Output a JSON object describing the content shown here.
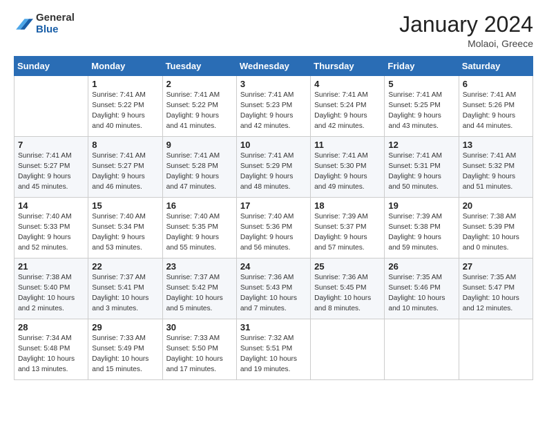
{
  "header": {
    "logo_general": "General",
    "logo_blue": "Blue",
    "month_title": "January 2024",
    "location": "Molaoi, Greece"
  },
  "days_of_week": [
    "Sunday",
    "Monday",
    "Tuesday",
    "Wednesday",
    "Thursday",
    "Friday",
    "Saturday"
  ],
  "weeks": [
    [
      {
        "day": "",
        "info": ""
      },
      {
        "day": "1",
        "info": "Sunrise: 7:41 AM\nSunset: 5:22 PM\nDaylight: 9 hours\nand 40 minutes."
      },
      {
        "day": "2",
        "info": "Sunrise: 7:41 AM\nSunset: 5:22 PM\nDaylight: 9 hours\nand 41 minutes."
      },
      {
        "day": "3",
        "info": "Sunrise: 7:41 AM\nSunset: 5:23 PM\nDaylight: 9 hours\nand 42 minutes."
      },
      {
        "day": "4",
        "info": "Sunrise: 7:41 AM\nSunset: 5:24 PM\nDaylight: 9 hours\nand 42 minutes."
      },
      {
        "day": "5",
        "info": "Sunrise: 7:41 AM\nSunset: 5:25 PM\nDaylight: 9 hours\nand 43 minutes."
      },
      {
        "day": "6",
        "info": "Sunrise: 7:41 AM\nSunset: 5:26 PM\nDaylight: 9 hours\nand 44 minutes."
      }
    ],
    [
      {
        "day": "7",
        "info": "Sunrise: 7:41 AM\nSunset: 5:27 PM\nDaylight: 9 hours\nand 45 minutes."
      },
      {
        "day": "8",
        "info": "Sunrise: 7:41 AM\nSunset: 5:27 PM\nDaylight: 9 hours\nand 46 minutes."
      },
      {
        "day": "9",
        "info": "Sunrise: 7:41 AM\nSunset: 5:28 PM\nDaylight: 9 hours\nand 47 minutes."
      },
      {
        "day": "10",
        "info": "Sunrise: 7:41 AM\nSunset: 5:29 PM\nDaylight: 9 hours\nand 48 minutes."
      },
      {
        "day": "11",
        "info": "Sunrise: 7:41 AM\nSunset: 5:30 PM\nDaylight: 9 hours\nand 49 minutes."
      },
      {
        "day": "12",
        "info": "Sunrise: 7:41 AM\nSunset: 5:31 PM\nDaylight: 9 hours\nand 50 minutes."
      },
      {
        "day": "13",
        "info": "Sunrise: 7:41 AM\nSunset: 5:32 PM\nDaylight: 9 hours\nand 51 minutes."
      }
    ],
    [
      {
        "day": "14",
        "info": "Sunrise: 7:40 AM\nSunset: 5:33 PM\nDaylight: 9 hours\nand 52 minutes."
      },
      {
        "day": "15",
        "info": "Sunrise: 7:40 AM\nSunset: 5:34 PM\nDaylight: 9 hours\nand 53 minutes."
      },
      {
        "day": "16",
        "info": "Sunrise: 7:40 AM\nSunset: 5:35 PM\nDaylight: 9 hours\nand 55 minutes."
      },
      {
        "day": "17",
        "info": "Sunrise: 7:40 AM\nSunset: 5:36 PM\nDaylight: 9 hours\nand 56 minutes."
      },
      {
        "day": "18",
        "info": "Sunrise: 7:39 AM\nSunset: 5:37 PM\nDaylight: 9 hours\nand 57 minutes."
      },
      {
        "day": "19",
        "info": "Sunrise: 7:39 AM\nSunset: 5:38 PM\nDaylight: 9 hours\nand 59 minutes."
      },
      {
        "day": "20",
        "info": "Sunrise: 7:38 AM\nSunset: 5:39 PM\nDaylight: 10 hours\nand 0 minutes."
      }
    ],
    [
      {
        "day": "21",
        "info": "Sunrise: 7:38 AM\nSunset: 5:40 PM\nDaylight: 10 hours\nand 2 minutes."
      },
      {
        "day": "22",
        "info": "Sunrise: 7:37 AM\nSunset: 5:41 PM\nDaylight: 10 hours\nand 3 minutes."
      },
      {
        "day": "23",
        "info": "Sunrise: 7:37 AM\nSunset: 5:42 PM\nDaylight: 10 hours\nand 5 minutes."
      },
      {
        "day": "24",
        "info": "Sunrise: 7:36 AM\nSunset: 5:43 PM\nDaylight: 10 hours\nand 7 minutes."
      },
      {
        "day": "25",
        "info": "Sunrise: 7:36 AM\nSunset: 5:45 PM\nDaylight: 10 hours\nand 8 minutes."
      },
      {
        "day": "26",
        "info": "Sunrise: 7:35 AM\nSunset: 5:46 PM\nDaylight: 10 hours\nand 10 minutes."
      },
      {
        "day": "27",
        "info": "Sunrise: 7:35 AM\nSunset: 5:47 PM\nDaylight: 10 hours\nand 12 minutes."
      }
    ],
    [
      {
        "day": "28",
        "info": "Sunrise: 7:34 AM\nSunset: 5:48 PM\nDaylight: 10 hours\nand 13 minutes."
      },
      {
        "day": "29",
        "info": "Sunrise: 7:33 AM\nSunset: 5:49 PM\nDaylight: 10 hours\nand 15 minutes."
      },
      {
        "day": "30",
        "info": "Sunrise: 7:33 AM\nSunset: 5:50 PM\nDaylight: 10 hours\nand 17 minutes."
      },
      {
        "day": "31",
        "info": "Sunrise: 7:32 AM\nSunset: 5:51 PM\nDaylight: 10 hours\nand 19 minutes."
      },
      {
        "day": "",
        "info": ""
      },
      {
        "day": "",
        "info": ""
      },
      {
        "day": "",
        "info": ""
      }
    ]
  ]
}
